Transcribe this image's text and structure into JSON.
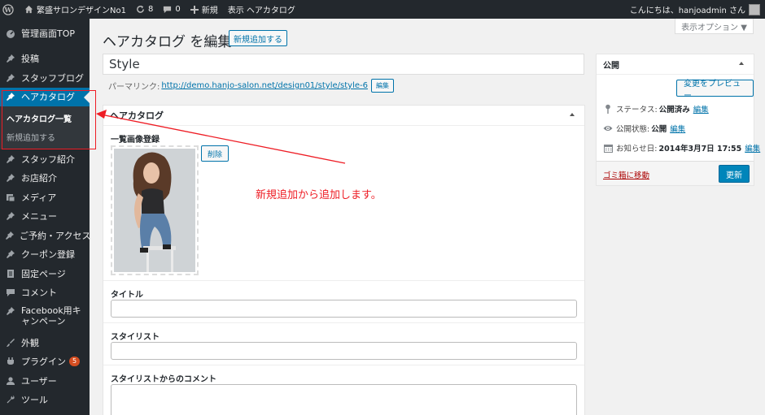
{
  "adminbar": {
    "site_name": "繁盛サロンデザインNo1",
    "updates_count": "8",
    "comments_count": "0",
    "new_label": "新規",
    "view_label": "表示 ヘアカタログ",
    "greeting": "こんにちは、hanjoadmin さん"
  },
  "sidebar": {
    "dashboard": "管理画面TOP",
    "posts": "投稿",
    "staff_blog": "スタッフブログ",
    "hair_catalog": "ヘアカタログ",
    "sub_list": "ヘアカタログ一覧",
    "sub_add": "新規追加する",
    "staff": "スタッフ紹介",
    "shop": "お店紹介",
    "media": "メディア",
    "menu": "メニュー",
    "reserve": "ご予約・アクセス",
    "coupon": "クーポン登録",
    "pages": "固定ページ",
    "comments": "コメント",
    "facebook": "Facebook用キャンペーン",
    "appearance": "外観",
    "plugins": "プラグイン",
    "plugins_badge": "5",
    "users": "ユーザー",
    "tools": "ツール"
  },
  "screen_options": "表示オプション ▼",
  "main": {
    "title": "ヘアカタログ を編集",
    "add_new": "新規追加する",
    "post_title": "Style",
    "permalink_label": "パーマリンク:",
    "permalink_url": "http://demo.hanjo-salon.net/design01/style/style-6",
    "edit_btn": "編集"
  },
  "catalog_box": {
    "heading": "ヘアカタログ",
    "image_label": "一覧画像登録",
    "delete_btn": "削除",
    "title_label": "タイトル",
    "stylist_label": "スタイリスト",
    "comment_label": "スタイリストからのコメント"
  },
  "publish": {
    "heading": "公開",
    "preview_btn": "変更をプレビュー",
    "status_label": "ステータス:",
    "status_value": "公開済み",
    "visibility_label": "公開状態:",
    "visibility_value": "公開",
    "date_label": "お知らせ日:",
    "date_value": "2014年3月7日 17:55",
    "edit_link": "編集",
    "trash_link": "ゴミ箱に移動",
    "update_btn": "更新"
  },
  "annotation": {
    "text": "新規追加から追加します。",
    "color": "#ee1c24"
  },
  "colors": {
    "admin_dark": "#23282d",
    "accent": "#0073aa",
    "primary_button": "#0085ba"
  }
}
